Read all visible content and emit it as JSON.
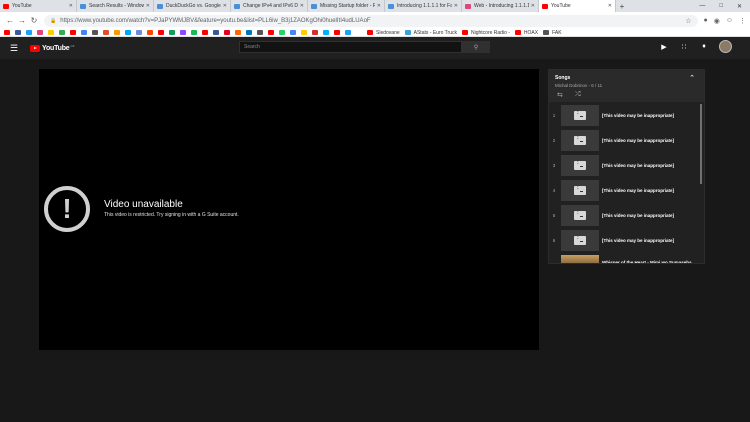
{
  "browser": {
    "tabs": [
      {
        "label": "YouTube",
        "color": "#ff0000",
        "active": false
      },
      {
        "label": "Search Results - Windows 1",
        "color": "#4a90d9",
        "active": false
      },
      {
        "label": "DuckDuckGo vs. Google",
        "color": "#4a90d9",
        "active": false
      },
      {
        "label": "Change IPv4 and IPv6 DNS",
        "color": "#4a90d9",
        "active": false
      },
      {
        "label": "Missing Startup folder - Ro",
        "color": "#4a90d9",
        "active": false
      },
      {
        "label": "Introducing 1.1.1.1 for Fam",
        "color": "#4a90d9",
        "active": false
      },
      {
        "label": "Web - Introducing 1.1.1.1 f",
        "color": "#e0457b",
        "active": false
      },
      {
        "label": "YouTube",
        "color": "#ff0000",
        "active": true
      }
    ],
    "new_tab": "+",
    "url": "https://www.youtube.com/watch?v=PJaPYWMJBV&feature=youtu.be&list=PLL6iw_B3j1ZAOKgOhi0huelItI4udLUAoF",
    "bookmarks_named": [
      {
        "label": "Sledovane",
        "color": "#ff0000"
      },
      {
        "label": "AStats - Euro Truck",
        "color": "#3aa1d8"
      },
      {
        "label": "Nightcore Radio -",
        "color": "#ff0000"
      },
      {
        "label": "HOAX",
        "color": "#ff0000"
      },
      {
        "label": "FAK",
        "color": "#555555"
      }
    ],
    "bookmark_icon_colors": [
      "#ff0000",
      "#3b5998",
      "#1da1f2",
      "#e0457b",
      "#ffcc00",
      "#34a853",
      "#ff0000",
      "#4285f4",
      "#555555",
      "#e44d26",
      "#ff9900",
      "#00a4ef",
      "#7289da",
      "#ff4500",
      "#ff0000",
      "#0f9d58",
      "#9146ff",
      "#1db954",
      "#ff0000",
      "#3b5998",
      "#e60023",
      "#ff6600",
      "#0077b5",
      "#555555",
      "#ff0000",
      "#25d366",
      "#4285f4",
      "#ffcc00",
      "#d32f2f",
      "#00b2ff",
      "#ff0000",
      "#1da1f2",
      "#ffffff"
    ]
  },
  "youtube": {
    "logo_text": "YouTube",
    "logo_region": "CZ",
    "search_placeholder": "Search",
    "player": {
      "error_title": "Video unavailable",
      "error_message": "This video is restricted. Try signing in with a G Suite account."
    },
    "playlist": {
      "title": "Songs",
      "subtitle": "Michal Dobrinov - 6 / 11",
      "items": [
        {
          "index": "1",
          "title": "[This video may be inappropriate]",
          "thumb": "placeholder"
        },
        {
          "index": "2",
          "title": "[This video may be inappropriate]",
          "thumb": "placeholder"
        },
        {
          "index": "3",
          "title": "[This video may be inappropriate]",
          "thumb": "placeholder"
        },
        {
          "index": "4",
          "title": "[This video may be inappropriate]",
          "thumb": "placeholder"
        },
        {
          "index": "5",
          "title": "[This video may be inappropriate]",
          "thumb": "placeholder"
        },
        {
          "index": "6",
          "title": "[This video may be inappropriate]",
          "thumb": "placeholder"
        },
        {
          "index": "",
          "title": "Whisper of the Heart - Mimi wo Sumaseba - Country Roads",
          "thumb": "art"
        }
      ]
    }
  }
}
